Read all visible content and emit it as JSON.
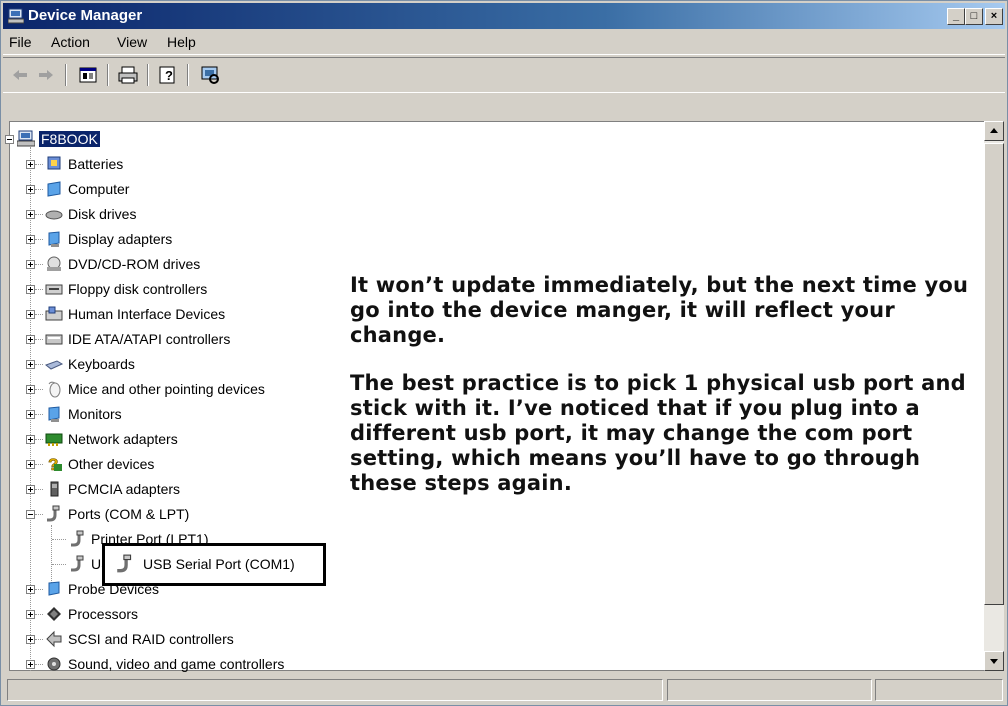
{
  "window": {
    "title": "Device Manager",
    "controls": [
      "_",
      "□",
      "×"
    ]
  },
  "menu": [
    "File",
    "Action",
    "View",
    "Help"
  ],
  "toolbar": {
    "buttons": [
      "back-arrow-icon",
      "forward-arrow-icon",
      "properties-icon",
      "print-icon",
      "help-icon",
      "scan-hardware-icon"
    ]
  },
  "tree": {
    "root": "F8BOOK",
    "items": [
      {
        "label": "Batteries",
        "icon": "battery-icon",
        "expanded": false
      },
      {
        "label": "Computer",
        "icon": "computer-icon",
        "expanded": false
      },
      {
        "label": "Disk drives",
        "icon": "disk-drive-icon",
        "expanded": false
      },
      {
        "label": "Display adapters",
        "icon": "display-adapter-icon",
        "expanded": false
      },
      {
        "label": "DVD/CD-ROM drives",
        "icon": "dvd-drive-icon",
        "expanded": false
      },
      {
        "label": "Floppy disk controllers",
        "icon": "floppy-controller-icon",
        "expanded": false
      },
      {
        "label": "Human Interface Devices",
        "icon": "hid-icon",
        "expanded": false
      },
      {
        "label": "IDE ATA/ATAPI controllers",
        "icon": "ide-controller-icon",
        "expanded": false
      },
      {
        "label": "Keyboards",
        "icon": "keyboard-icon",
        "expanded": false
      },
      {
        "label": "Mice and other pointing devices",
        "icon": "mouse-icon",
        "expanded": false
      },
      {
        "label": "Monitors",
        "icon": "monitor-icon",
        "expanded": false
      },
      {
        "label": "Network adapters",
        "icon": "network-adapter-icon",
        "expanded": false
      },
      {
        "label": "Other devices",
        "icon": "unknown-device-icon",
        "expanded": false
      },
      {
        "label": "PCMCIA adapters",
        "icon": "pcmcia-icon",
        "expanded": false
      },
      {
        "label": "Ports (COM & LPT)",
        "icon": "port-icon",
        "expanded": true,
        "children": [
          {
            "label": "Printer Port (LPT1)",
            "icon": "port-icon"
          },
          {
            "label": "USB Serial Port (COM1)",
            "icon": "port-icon"
          }
        ]
      },
      {
        "label": "Probe Devices",
        "icon": "probe-icon",
        "expanded": false
      },
      {
        "label": "Processors",
        "icon": "processor-icon",
        "expanded": false
      },
      {
        "label": "SCSI and RAID controllers",
        "icon": "scsi-icon",
        "expanded": false
      },
      {
        "label": "Sound, video and game controllers",
        "icon": "sound-icon",
        "expanded": false
      }
    ]
  },
  "annotation": {
    "paragraph1": "It won’t update immediately, but the next time you go into the device manger, it will reflect your change.",
    "paragraph2": "The best practice is to pick 1 physical usb port and stick with it. I’ve noticed that if you plug into a different usb port, it may change the com port setting, which means you’ll have to go through these steps again."
  },
  "colors": {
    "titlebar_start": "#0a246a",
    "titlebar_end": "#a6caf0",
    "selection": "#0a246a"
  }
}
